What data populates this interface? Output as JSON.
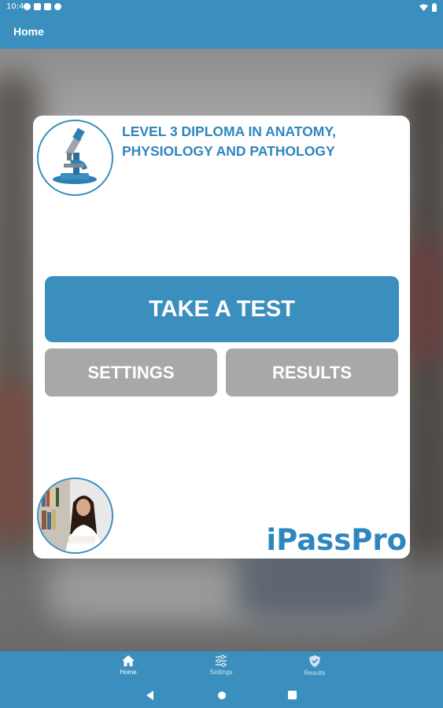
{
  "status_bar": {
    "time": "10:42"
  },
  "app_bar": {
    "title": "Home"
  },
  "card": {
    "course_title": "LEVEL 3 DIPLOMA IN ANATOMY, PHYSIOLOGY AND PATHOLOGY",
    "take_test_label": "TAKE A TEST",
    "settings_label": "SETTINGS",
    "results_label": "RESULTS",
    "brand": "iPassPro"
  },
  "bottom_nav": {
    "items": [
      {
        "label": "Home",
        "icon": "home-icon",
        "active": true
      },
      {
        "label": "Settings",
        "icon": "sliders-icon",
        "active": false
      },
      {
        "label": "Results",
        "icon": "shield-icon",
        "active": false
      }
    ]
  },
  "colors": {
    "primary": "#3a8fbe",
    "title_text": "#2e86bf",
    "secondary_button": "#a8a8a8"
  }
}
